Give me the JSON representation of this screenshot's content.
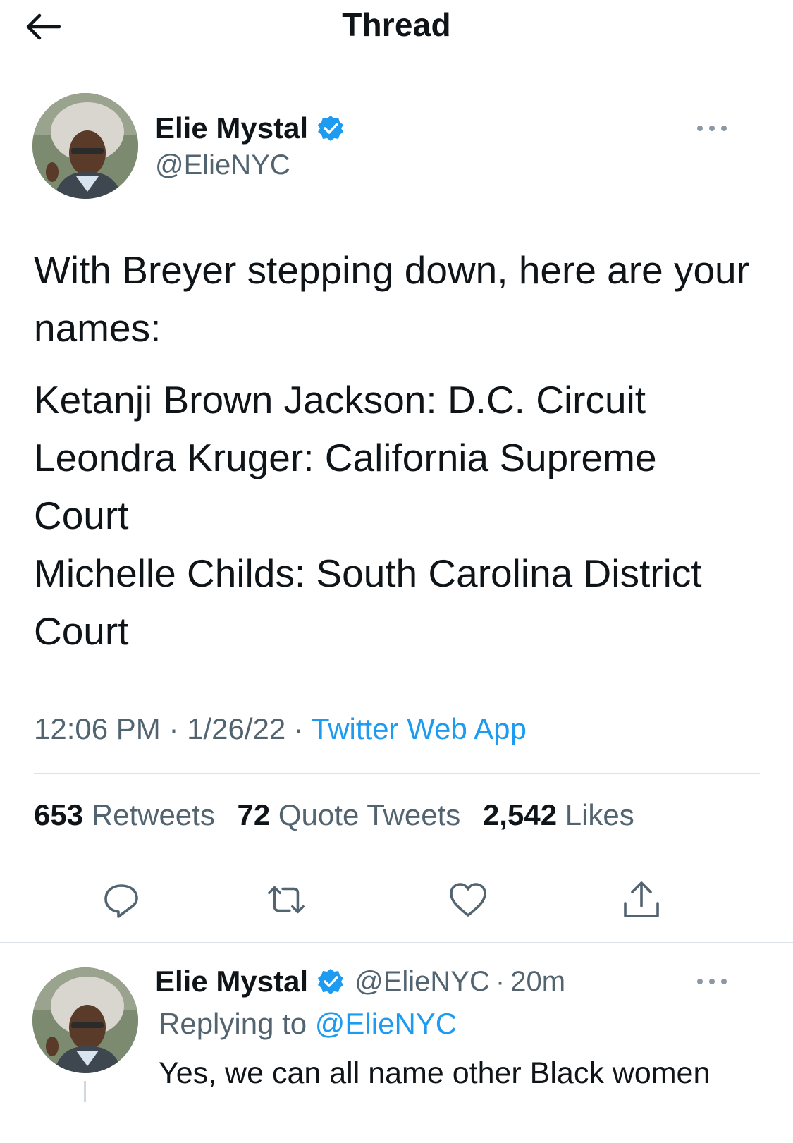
{
  "header": {
    "title": "Thread",
    "back_icon": "arrow-left-icon"
  },
  "main_tweet": {
    "author_name": "Elie Mystal",
    "author_handle": "@ElieNYC",
    "paragraphs": [
      "With Breyer stepping down, here are your names:",
      "Ketanji Brown Jackson: D.C. Circuit\nLeondra Kruger: California Supreme Court\nMichelle Childs: South Carolina District Court"
    ],
    "time": "12:06 PM",
    "date": "1/26/22",
    "separator": "·",
    "source": "Twitter Web App",
    "stats": [
      {
        "count": "653",
        "label": "Retweets"
      },
      {
        "count": "72",
        "label": "Quote Tweets"
      },
      {
        "count": "2,542",
        "label": "Likes"
      }
    ],
    "actions": [
      "reply-icon",
      "retweet-icon",
      "like-icon",
      "share-icon"
    ]
  },
  "reply_tweet": {
    "author_name": "Elie Mystal",
    "author_handle": "@ElieNYC",
    "separator": "·",
    "age": "20m",
    "replying_prefix": "Replying to",
    "replying_to": "@ElieNYC",
    "text": "Yes, we can all name other Black women"
  },
  "colors": {
    "accent": "#1d9bf0",
    "text": "#0f1419",
    "secondary": "#536471",
    "divider": "#dde3e8"
  }
}
